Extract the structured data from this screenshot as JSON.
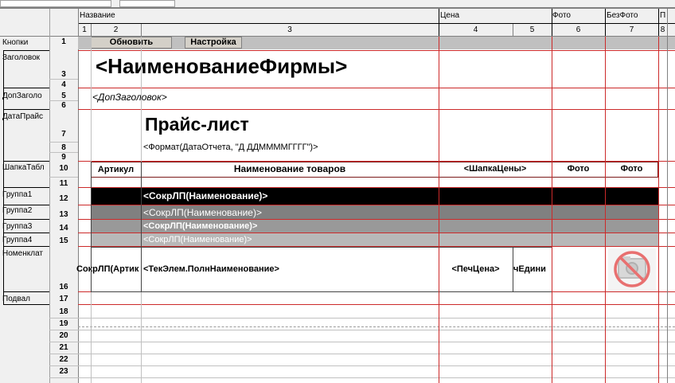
{
  "colors": {
    "header_bg": "#f0f0f0",
    "grid_grey": "#c0c0c0",
    "grid_red": "#cc2a2a",
    "group1": "#000000",
    "group2": "#808080",
    "group3": "#999999",
    "group4": "#b8b8b8"
  },
  "section_headers": [
    {
      "key": "name",
      "label": "Название"
    },
    {
      "key": "price",
      "label": "Цена"
    },
    {
      "key": "photo",
      "label": "Фото"
    },
    {
      "key": "nophoto",
      "label": "БезФото"
    },
    {
      "key": "p",
      "label": "П"
    }
  ],
  "columns": [
    "1",
    "2",
    "3",
    "4",
    "5",
    "6",
    "7",
    "8"
  ],
  "row_sections": [
    "Кнопки",
    "Заголовок",
    "ДопЗаголо",
    "ДатаПрайс",
    "ШапкаТабл",
    "Группа1",
    "Группа2",
    "Группа3",
    "Группа4",
    "Номенклат",
    "Подвал"
  ],
  "rows": [
    "1",
    "2",
    "3",
    "4",
    "5",
    "6",
    "7",
    "8",
    "9",
    "10",
    "11",
    "12",
    "13",
    "14",
    "15",
    "16",
    "17",
    "18",
    "19",
    "20",
    "21",
    "22",
    "23"
  ],
  "buttons": {
    "refresh": "Обновить",
    "settings": "Настройка"
  },
  "cells": {
    "company": "<НаименованиеФирмы>",
    "extra_header": "<ДопЗаголовок>",
    "price_list_title": "Прайс-лист",
    "report_date": "<Формат(ДатаОтчета, \"Д ДДММММГГГГ\")>",
    "col_article": "Артикул",
    "col_goods_name": "Наименование товаров",
    "col_price_header": "<ШапкаЦены>",
    "col_photo1": "Фото",
    "col_photo2": "Фото",
    "group1": "<СокрЛП(Наименование)>",
    "group2": "<СокрЛП(Наименование)>",
    "group3": "<СокрЛП(Наименование)>",
    "group4": "<СокрЛП(Наименование)>",
    "item_article": "СокрЛП(Артик",
    "item_name": "<ТекЭлем.ПолнНаименование>",
    "item_price": "<ПечЦена>",
    "item_unit": "чЕдини"
  },
  "icons": {
    "no_photo": "no-photo-icon"
  }
}
